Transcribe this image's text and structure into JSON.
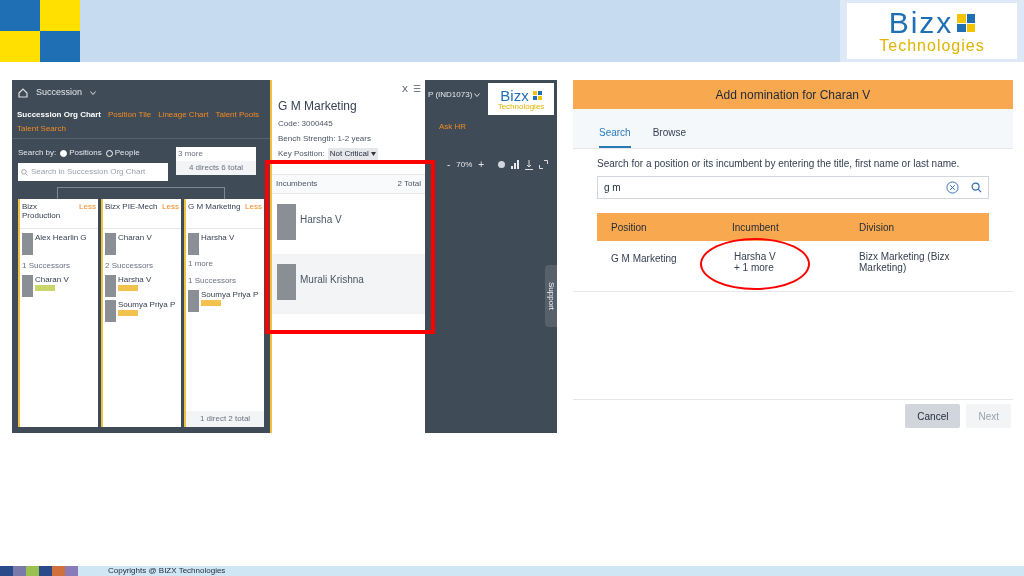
{
  "header": {
    "logo_word": "Bizx",
    "logo_sub": "Technologies"
  },
  "left_screenshot": {
    "module": "Succession",
    "tabs": [
      {
        "label": "Succession Org Chart",
        "selected": true
      },
      {
        "label": "Position Tile",
        "selected": false
      },
      {
        "label": "Lineage Chart",
        "selected": false
      },
      {
        "label": "Talent Pools",
        "selected": false
      },
      {
        "label": "Talent Search",
        "selected": false
      }
    ],
    "search_by": "Search by:",
    "search_options": [
      {
        "label": "Positions",
        "selected": true
      },
      {
        "label": "People",
        "selected": false
      }
    ],
    "search_placeholder": "Search in Succession Org Chart",
    "top_node": {
      "text": "3 more",
      "footer": "4 directs 6 total"
    },
    "cards": [
      {
        "title": "Bizx Production",
        "toggle": "Less",
        "incumbent": "Alex Hearlin G",
        "successor_count": "1 Successors",
        "successors": [
          {
            "name": "Charan V",
            "color": "#c8d66a"
          }
        ]
      },
      {
        "title": "Bizx PIE-Mech",
        "toggle": "Less",
        "incumbent": "Charan V",
        "successor_count": "2 Successors",
        "successors": [
          {
            "name": "Harsha V",
            "color": "#f2c14e"
          },
          {
            "name": "Soumya Priya P",
            "color": "#f2c14e"
          }
        ]
      },
      {
        "title": "G M Marketing",
        "toggle": "Less",
        "incumbent": "Harsha V",
        "more": "1 more",
        "successor_count": "1 Successors",
        "successors": [
          {
            "name": "Soumya Priya P",
            "color": "#f2c14e"
          }
        ],
        "footer": "1 direct 2 total"
      }
    ],
    "panel": {
      "close": "X",
      "menu": "☰",
      "title": "G M Marketing",
      "code": "Code: 3000445",
      "bench": "Bench Strength: 1-2 years",
      "key_label": "Key Position:",
      "key_value": "Not Critical",
      "incumbents_label": "Incumbents",
      "total": "2 Total",
      "incumbents": [
        {
          "name": "Harsha V",
          "selected": false
        },
        {
          "name": "Murali Krishna",
          "selected": true
        }
      ]
    },
    "user": "P (IND1073)",
    "nav": "Ask HR",
    "zoom": {
      "minus": "-",
      "value": "70%",
      "plus": "+"
    },
    "support": "Support",
    "logo_word": "Bizx",
    "logo_sub": "Technologies"
  },
  "right_screenshot": {
    "title": "Add nomination for Charan V",
    "tabs": [
      {
        "label": "Search",
        "selected": true
      },
      {
        "label": "Browse",
        "selected": false
      }
    ],
    "instruction": "Search for a position or its incumbent by entering the title, first name or last name.",
    "search_value": "g m",
    "columns": [
      "Position",
      "Incumbent",
      "Division"
    ],
    "rows": [
      {
        "position": "G M Marketing",
        "incumbent": "Harsha V",
        "incumbent_more": "+ 1 more",
        "division": "Bizx Marketing (Bizx Marketing)"
      }
    ],
    "buttons": [
      {
        "label": "Cancel",
        "disabled": false
      },
      {
        "label": "Next",
        "disabled": true
      }
    ]
  },
  "footer": {
    "copyright": "Copyrights @ BIZX Technologies"
  }
}
